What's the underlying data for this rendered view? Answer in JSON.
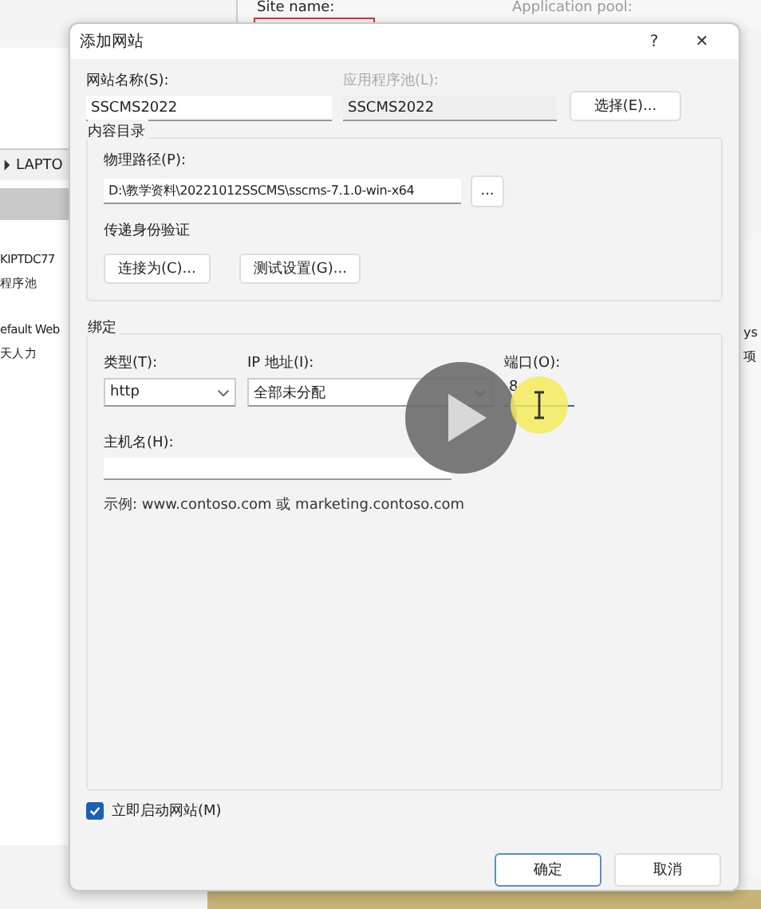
{
  "background": {
    "site_label": "Site name:",
    "pool_label": "Application pool:",
    "tree_crumb": "LAPTO",
    "left_items": [
      "KIPTDC77",
      "程序池",
      "efault Web",
      "天人力"
    ],
    "right_items": [
      "ys",
      "项"
    ]
  },
  "dialog": {
    "title": "添加网站",
    "help": "?",
    "close": "✕",
    "site_name": {
      "label": "网站名称(S):",
      "value": "SSCMS2022"
    },
    "app_pool": {
      "label": "应用程序池(L):",
      "value": "SSCMS2022",
      "disabled": true
    },
    "select_button": "选择(E)...",
    "content": {
      "legend": "内容目录",
      "path_label": "物理路径(P):",
      "path_value": "D:\\教学资料\\20221012SSCMS\\sscms-7.1.0-win-x64",
      "browse_button": "...",
      "auth_label": "传递身份验证",
      "connect_button": "连接为(C)...",
      "test_button": "测试设置(G)..."
    },
    "binding": {
      "legend": "绑定",
      "type_label": "类型(T):",
      "type_value": "http",
      "ip_label": "IP 地址(I):",
      "ip_value": "全部未分配",
      "port_label": "端口(O):",
      "port_value": "8",
      "host_label": "主机名(H):",
      "example": "示例: www.contoso.com 或 marketing.contoso.com"
    },
    "start_now": {
      "label": "立即启动网站(M)",
      "checked": true
    },
    "buttons": [
      {
        "label": "确定",
        "default": true
      },
      {
        "label": "取消",
        "default": false
      }
    ]
  },
  "overlay": {
    "play": true
  }
}
